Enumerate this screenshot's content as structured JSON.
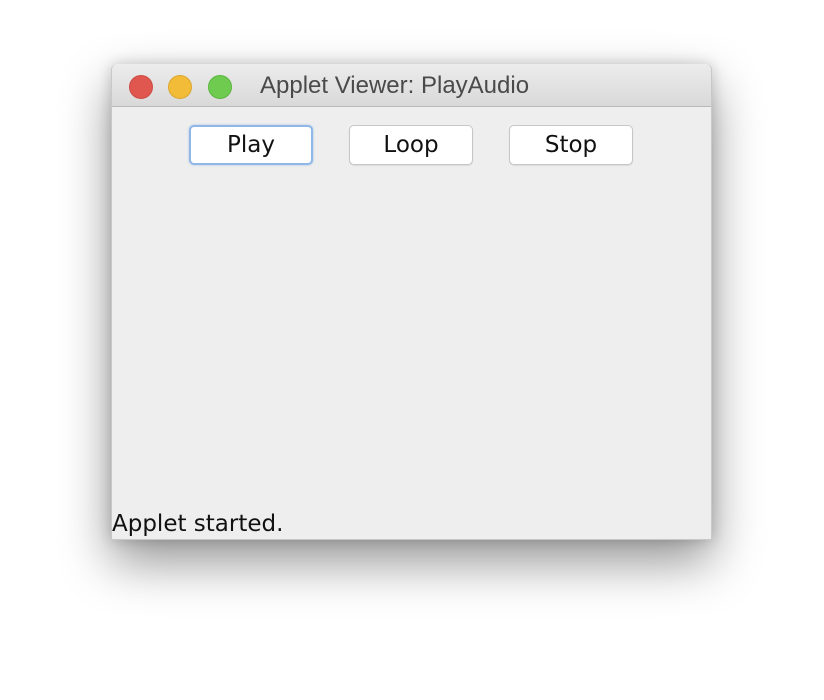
{
  "window": {
    "title": "Applet Viewer: PlayAudio"
  },
  "controls": {
    "close_icon": "close-icon",
    "minimize_icon": "minimize-icon",
    "zoom_icon": "zoom-icon"
  },
  "toolbar": {
    "play_label": "Play",
    "loop_label": "Loop",
    "stop_label": "Stop"
  },
  "status": {
    "text": "Applet started."
  },
  "colors": {
    "close": "#e0574f",
    "minimize": "#f2bc38",
    "zoom": "#6fcb4f",
    "focus_ring": "#8fb8e8",
    "content_bg": "#eeeeee"
  }
}
